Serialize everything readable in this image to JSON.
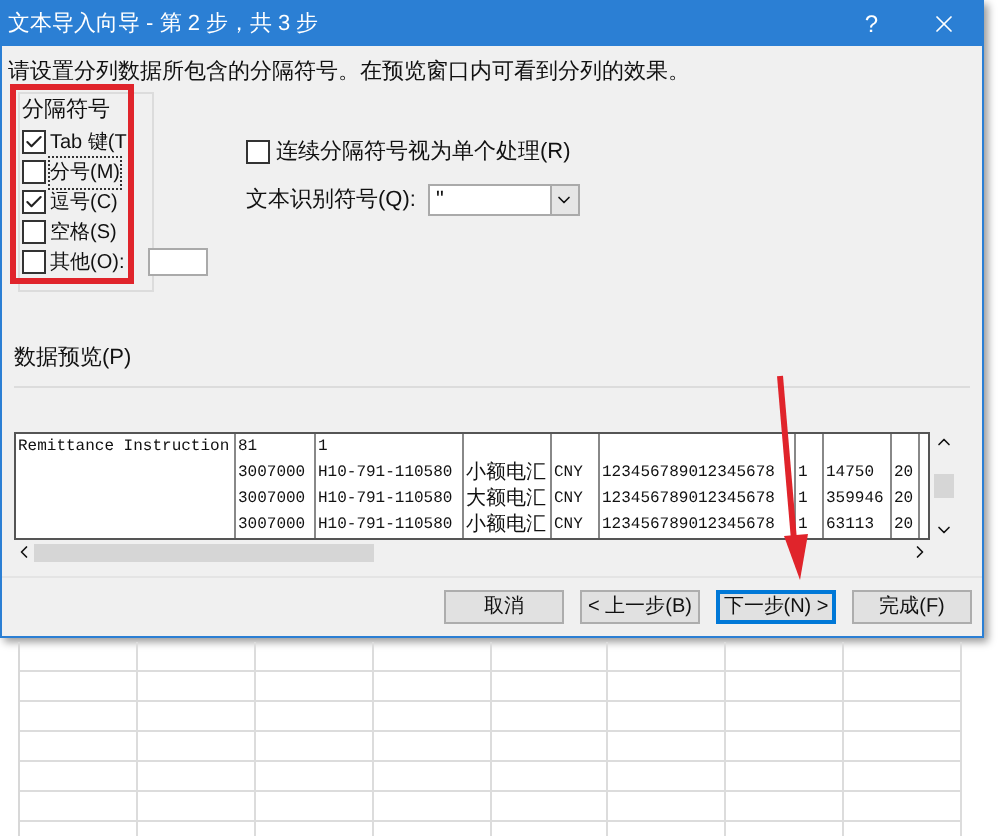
{
  "window": {
    "title": "文本导入向导 - 第 2 步，共 3 步",
    "help": "?"
  },
  "instruction": "请设置分列数据所包含的分隔符号。在预览窗口内可看到分列的效果。",
  "delimiters": {
    "title": "分隔符号",
    "options": [
      {
        "label": "Tab 键(T",
        "checked": true,
        "focused": false,
        "kind": "plain"
      },
      {
        "label": "分号(M)",
        "checked": false,
        "focused": true,
        "kind": "plain"
      },
      {
        "label": "逗号(C)",
        "checked": true,
        "focused": false,
        "kind": "plain"
      },
      {
        "label": "空格(S)",
        "checked": false,
        "focused": false,
        "kind": "plain"
      },
      {
        "label": "其他(O):",
        "checked": false,
        "focused": false,
        "kind": "other"
      }
    ]
  },
  "consecutive": {
    "label": "连续分隔符号视为单个处理(R)",
    "checked": false
  },
  "qualifier": {
    "label": "文本识别符号(Q):",
    "value": "\""
  },
  "preview": {
    "title": "数据预览(P)",
    "rows": [
      [
        "Remittance Instruction",
        "81",
        "1",
        "",
        "",
        "",
        "",
        "",
        ""
      ],
      [
        "",
        "3007000",
        "H10-791-110580",
        "小额电汇",
        "CNY",
        "123456789012345678",
        "1",
        "14750",
        "20"
      ],
      [
        "",
        "3007000",
        "H10-791-110580",
        "大额电汇",
        "CNY",
        "123456789012345678",
        "1",
        "359946",
        "20"
      ],
      [
        "",
        "3007000",
        "H10-791-110580",
        "小额电汇",
        "CNY",
        "123456789012345678",
        "1",
        "63113",
        "20"
      ]
    ]
  },
  "buttons": [
    {
      "label": "取消",
      "focused": false
    },
    {
      "label": "< 上一步(B)",
      "focused": false
    },
    {
      "label": "下一步(N) >",
      "focused": true
    },
    {
      "label": "完成(F)",
      "focused": false
    }
  ]
}
